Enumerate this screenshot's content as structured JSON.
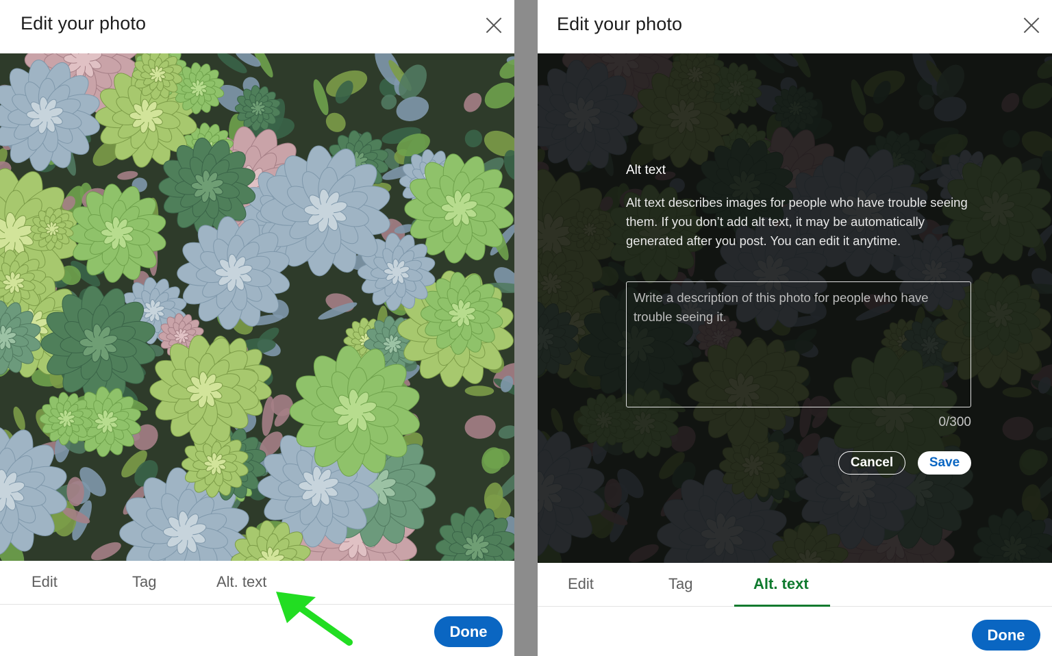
{
  "left_panel": {
    "title": "Edit your photo",
    "tabs": [
      {
        "label": "Edit",
        "active": false
      },
      {
        "label": "Tag",
        "active": false
      },
      {
        "label": "Alt. text",
        "active": false
      }
    ],
    "done_label": "Done"
  },
  "right_panel": {
    "title": "Edit your photo",
    "alt_text": {
      "heading": "Alt text",
      "description": "Alt text describes images for people who have trouble seeing them. If you don’t add alt text, it may be automatically generated after you post. You can edit it anytime.",
      "placeholder": "Write a description of this photo for people who have trouble seeing it.",
      "counter": "0/300",
      "cancel_label": "Cancel",
      "save_label": "Save"
    },
    "tabs": [
      {
        "label": "Edit",
        "active": false
      },
      {
        "label": "Tag",
        "active": false
      },
      {
        "label": "Alt. text",
        "active": true
      }
    ],
    "done_label": "Done"
  },
  "colors": {
    "accent_blue": "#0a66c2",
    "active_tab_green": "#0f7a2e",
    "annotation_arrow": "#22dd22"
  },
  "icons": {
    "close": "close-icon",
    "annotation": "green-arrow-icon"
  }
}
